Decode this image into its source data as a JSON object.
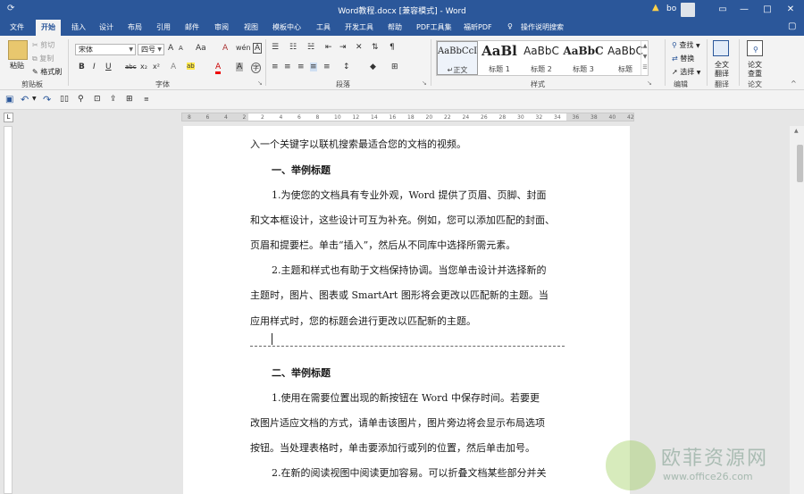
{
  "title_bar": {
    "doc_title": "Word教程.docx [兼容模式] - Word",
    "warning_icon": "warning-icon",
    "user_name": "bo"
  },
  "tabs": [
    "文件",
    "开始",
    "插入",
    "设计",
    "布局",
    "引用",
    "邮件",
    "审阅",
    "视图",
    "模板中心",
    "工具",
    "开发工具",
    "帮助",
    "PDF工具集",
    "福昕PDF",
    "操作说明搜索"
  ],
  "active_tab": "开始",
  "ribbon": {
    "clipboard": {
      "paste": "粘贴",
      "cut": "剪切",
      "copy": "复制",
      "format_painter": "格式刷",
      "group": "剪贴板"
    },
    "font": {
      "name": "宋体",
      "size": "四号",
      "group": "字体",
      "bold": "B",
      "italic": "I",
      "underline": "U",
      "strike": "abc",
      "sub": "x₂",
      "sup": "x²",
      "grow": "A",
      "shrink": "A",
      "case": "Aa",
      "clear": "A",
      "pinyin": "wén",
      "border": "A",
      "highlight": "ab",
      "color": "A",
      "char_shade": "A",
      "circle": "字"
    },
    "paragraph": {
      "group": "段落"
    },
    "styles": {
      "group": "样式",
      "items": [
        {
          "preview": "AaBbCcI",
          "name": "↵正文"
        },
        {
          "preview": "AaBl",
          "name": "标题 1"
        },
        {
          "preview": "AaBbC",
          "name": "标题 2"
        },
        {
          "preview": "AaBbC",
          "name": "标题 3"
        },
        {
          "preview": "AaBbC",
          "name": "标题"
        }
      ]
    },
    "editing": {
      "find": "查找",
      "replace": "替换",
      "select": "选择",
      "group": "编辑"
    },
    "translate": {
      "label1": "全文",
      "label2": "翻译",
      "group": "翻译"
    },
    "paper": {
      "label1": "论文",
      "label2": "查重",
      "group": "论文"
    }
  },
  "ruler_ticks": [
    "8",
    "6",
    "4",
    "2",
    "2",
    "4",
    "6",
    "8",
    "10",
    "12",
    "14",
    "16",
    "18",
    "20",
    "22",
    "24",
    "26",
    "28",
    "30",
    "32",
    "34",
    "36",
    "38",
    "40",
    "42"
  ],
  "document": {
    "lines": [
      {
        "text": "入一个关键字以联机搜索最适合您的文档的视频。",
        "heading": false,
        "indent": false
      },
      {
        "text": "一、举例标题",
        "heading": true,
        "indent": true
      },
      {
        "text": "1.为使您的文档具有专业外观，Word 提供了页眉、页脚、封面",
        "heading": false,
        "indent": true
      },
      {
        "text": "和文本框设计，这些设计可互为补充。例如，您可以添加匹配的封面、",
        "heading": false,
        "indent": false
      },
      {
        "text": "页眉和提要栏。单击“插入”，然后从不同库中选择所需元素。",
        "heading": false,
        "indent": false
      },
      {
        "text": "2.主题和样式也有助于文档保持协调。当您单击设计并选择新的",
        "heading": false,
        "indent": true
      },
      {
        "text": "主题时，图片、图表或 SmartArt 图形将会更改以匹配新的主题。当",
        "heading": false,
        "indent": false
      },
      {
        "text": "应用样式时，您的标题会进行更改以匹配新的主题。",
        "heading": false,
        "indent": false
      },
      {
        "text": "二、举例标题",
        "heading": true,
        "indent": true
      },
      {
        "text": "1.使用在需要位置出现的新按钮在 Word 中保存时间。若要更",
        "heading": false,
        "indent": true
      },
      {
        "text": "改图片适应文档的方式，请单击该图片，图片旁边将会显示布局选项",
        "heading": false,
        "indent": false
      },
      {
        "text": "按钮。当处理表格时，单击要添加行或列的位置，然后单击加号。",
        "heading": false,
        "indent": false
      },
      {
        "text": "2.在新的阅读视图中阅读更加容易。可以折叠文档某些部分并关",
        "heading": false,
        "indent": true
      }
    ]
  },
  "watermark": {
    "cn": "欧菲资源网",
    "url": "www.office26.com"
  }
}
